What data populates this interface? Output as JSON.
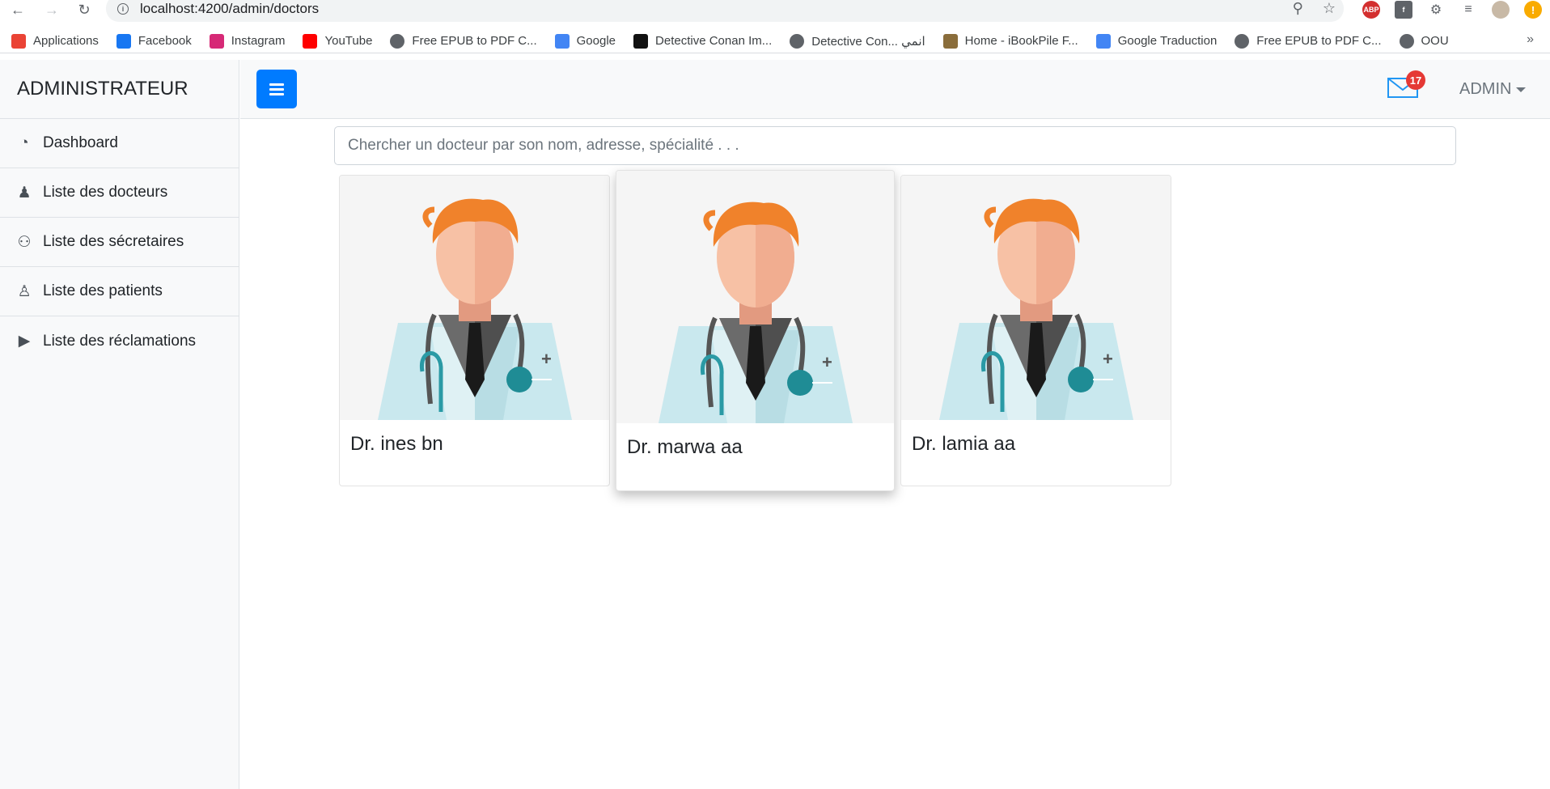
{
  "browser": {
    "url": "localhost:4200/admin/doctors",
    "bookmarks": [
      {
        "label": "Applications",
        "icon": "apps-grid-icon",
        "color": "#ea4335"
      },
      {
        "label": "Facebook",
        "icon": "facebook-icon",
        "color": "#1877f2"
      },
      {
        "label": "Instagram",
        "icon": "instagram-icon",
        "color": "#d62976"
      },
      {
        "label": "YouTube",
        "icon": "youtube-icon",
        "color": "#ff0000"
      },
      {
        "label": "Free EPUB to PDF C...",
        "icon": "globe-icon",
        "color": "#5f6368"
      },
      {
        "label": "Google",
        "icon": "google-icon",
        "color": "#4285f4"
      },
      {
        "label": "Detective Conan Im...",
        "icon": "conan-icon",
        "color": "#111111"
      },
      {
        "label": "Detective Con... انمي",
        "icon": "globe-icon",
        "color": "#5f6368"
      },
      {
        "label": "Home - iBookPile F...",
        "icon": "book-icon",
        "color": "#8a6d3b"
      },
      {
        "label": "Google Traduction",
        "icon": "translate-icon",
        "color": "#4285f4"
      },
      {
        "label": "Free EPUB to PDF C...",
        "icon": "globe-icon",
        "color": "#5f6368"
      },
      {
        "label": "OOU",
        "icon": "globe-icon",
        "color": "#5f6368"
      }
    ],
    "more": "»"
  },
  "sidebar": {
    "heading": "ADMINISTRATEUR",
    "items": [
      {
        "label": "Dashboard",
        "icon": "dashboard-icon"
      },
      {
        "label": "Liste des docteurs",
        "icon": "doctor-icon"
      },
      {
        "label": "Liste des sécretaires",
        "icon": "users-icon"
      },
      {
        "label": "Liste des patients",
        "icon": "user-icon"
      },
      {
        "label": "Liste des réclamations",
        "icon": "bullhorn-icon"
      }
    ]
  },
  "topnav": {
    "mail_count": "17",
    "user_label": "ADMIN"
  },
  "search": {
    "placeholder": "Chercher un docteur par son nom, adresse, spécialité . . ."
  },
  "doctors": [
    {
      "name": "Dr. ines bn"
    },
    {
      "name": "Dr. marwa aa"
    },
    {
      "name": "Dr. lamia aa"
    }
  ],
  "colors": {
    "primary": "#007bff",
    "badge": "#e53935",
    "hair": "#f0822b",
    "coat": "#c9e8ee"
  }
}
